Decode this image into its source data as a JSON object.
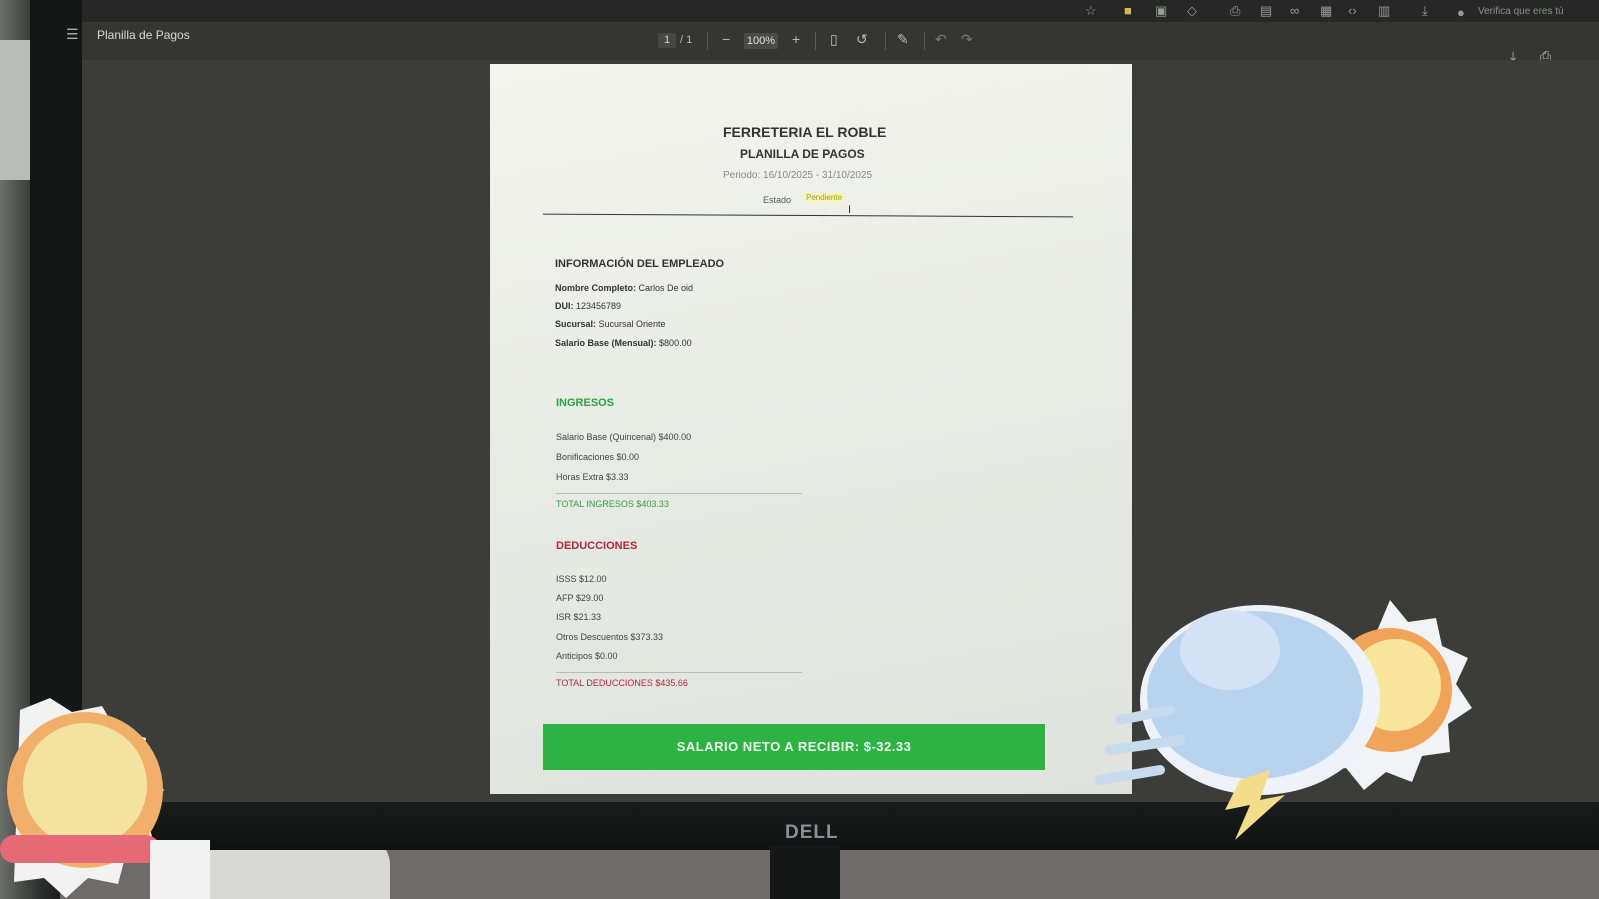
{
  "browser": {
    "verify_text": "Verifica que eres tú"
  },
  "toolbar": {
    "doc_title": "Planilla de Pagos",
    "page_current": "1",
    "page_total": "/ 1",
    "zoom_out": "−",
    "zoom_value": "100%",
    "zoom_in": "+"
  },
  "document": {
    "company": "FERRETERIA EL ROBLE",
    "subtitle": "PLANILLA DE PAGOS",
    "period": "Periodo: 16/10/2025 - 31/10/2025",
    "status_label": "Estado",
    "status_value": "Pendiente",
    "employee_section": {
      "title": "INFORMACIÓN DEL EMPLEADO",
      "fields": [
        {
          "label": "Nombre Completo:",
          "value": "Carlos De oid"
        },
        {
          "label": "DUI:",
          "value": "123456789"
        },
        {
          "label": "Sucursal:",
          "value": "Sucursal Oriente"
        },
        {
          "label": "Salario Base (Mensual):",
          "value": "$800.00"
        }
      ]
    },
    "income": {
      "title": "INGRESOS",
      "items": [
        "Salario Base (Quincenal) $400.00",
        "Bonificaciones $0.00",
        "Horas Extra $3.33"
      ],
      "total": "TOTAL INGRESOS $403.33"
    },
    "deductions": {
      "title": "DEDUCCIONES",
      "items": [
        "ISSS $12.00",
        "AFP $29.00",
        "ISR $21.33",
        "Otros Descuentos $373.33",
        "Anticipos $0.00"
      ],
      "total": "TOTAL DEDUCCIONES $435.66"
    },
    "net_salary": "SALARIO NETO A RECIBIR: $-32.33"
  },
  "hardware": {
    "brand": "DELL"
  }
}
